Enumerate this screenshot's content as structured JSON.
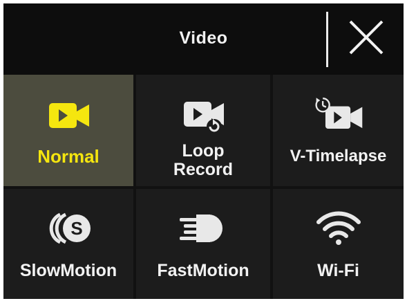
{
  "header": {
    "title": "Video"
  },
  "colors": {
    "accent": "#f5e60f",
    "text": "#f2f2f2",
    "background": "#111111",
    "selected_tile": "#4c4c3e"
  },
  "modes": [
    {
      "label": "Normal",
      "icon": "video-camera-icon",
      "selected": true
    },
    {
      "label_line1": "Loop",
      "label_line2": "Record",
      "icon": "loop-record-icon",
      "selected": false
    },
    {
      "label": "V-Timelapse",
      "icon": "timelapse-icon",
      "selected": false
    },
    {
      "label": "SlowMotion",
      "icon": "slow-motion-icon",
      "selected": false
    },
    {
      "label": "FastMotion",
      "icon": "fast-motion-icon",
      "selected": false
    },
    {
      "label": "Wi-Fi",
      "icon": "wifi-icon",
      "selected": false
    }
  ]
}
